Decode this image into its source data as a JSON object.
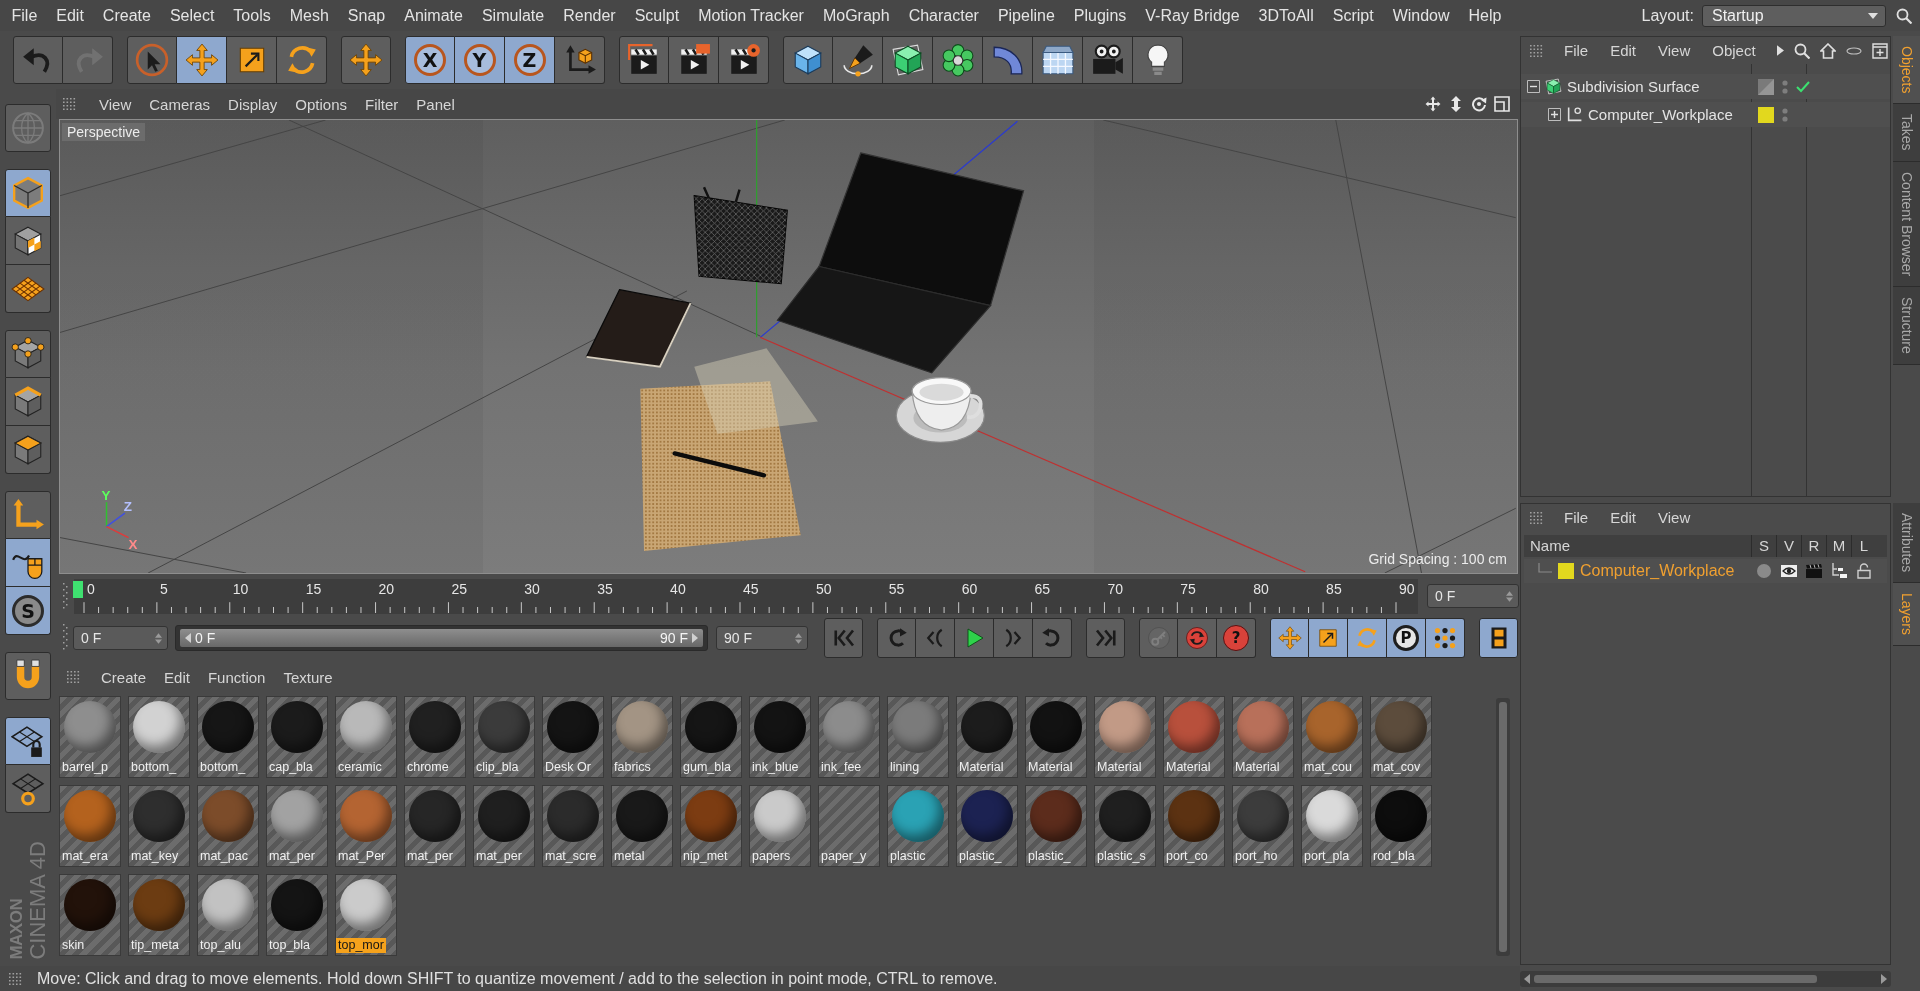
{
  "menu_bar": {
    "items": [
      "File",
      "Edit",
      "Create",
      "Select",
      "Tools",
      "Mesh",
      "Snap",
      "Animate",
      "Simulate",
      "Render",
      "Sculpt",
      "Motion Tracker",
      "MoGraph",
      "Character",
      "Pipeline",
      "Plugins",
      "V-Ray Bridge",
      "3DToAll",
      "Script",
      "Window",
      "Help"
    ],
    "layout_label": "Layout:",
    "layout_value": "Startup"
  },
  "toolbar": [
    [
      {
        "kind": "undo",
        "disabled": false
      },
      {
        "kind": "redo",
        "disabled": true
      }
    ],
    [
      {
        "kind": "live_select",
        "selected": false
      },
      {
        "kind": "move",
        "selected": true
      },
      {
        "kind": "scale",
        "selected": false
      },
      {
        "kind": "rotate",
        "selected": false
      }
    ],
    [
      {
        "kind": "recent_tool",
        "selected": false
      }
    ],
    [
      {
        "kind": "axis_lock",
        "label": "X",
        "selected": true
      },
      {
        "kind": "axis_lock",
        "label": "Y",
        "selected": true
      },
      {
        "kind": "axis_lock",
        "label": "Z",
        "selected": true
      },
      {
        "kind": "coordinate_system",
        "selected": false
      }
    ],
    [
      {
        "kind": "render_view"
      },
      {
        "kind": "render_picture"
      },
      {
        "kind": "render_settings"
      }
    ],
    [
      {
        "kind": "cube"
      },
      {
        "kind": "pen"
      },
      {
        "kind": "subdivision"
      },
      {
        "kind": "cloner"
      },
      {
        "kind": "bend"
      },
      {
        "kind": "floor"
      },
      {
        "kind": "camera"
      },
      {
        "kind": "light"
      }
    ]
  ],
  "left_toolbar": [
    [
      {
        "kind": "make_editable",
        "disabled": true
      }
    ],
    [
      {
        "kind": "model",
        "selected": true
      },
      {
        "kind": "texture",
        "selected": false
      },
      {
        "kind": "workplane",
        "selected": false
      }
    ],
    [
      {
        "kind": "points",
        "selected": false
      },
      {
        "kind": "edges",
        "selected": false
      },
      {
        "kind": "polygons",
        "selected": false
      }
    ],
    [
      {
        "kind": "axis",
        "selected": false
      },
      {
        "kind": "tweak",
        "selected": true
      },
      {
        "kind": "solo",
        "label": "S",
        "selected": true
      }
    ],
    [
      {
        "kind": "magnet",
        "selected": false
      }
    ],
    [
      {
        "kind": "lock_workplane",
        "selected": true
      },
      {
        "kind": "planar_workplane",
        "selected": false
      }
    ]
  ],
  "logo": {
    "brand": "MAXON",
    "product": "CINEMA 4D"
  },
  "viewport": {
    "menu": [
      "View",
      "Cameras",
      "Display",
      "Options",
      "Filter",
      "Panel"
    ],
    "camera": "Perspective",
    "grid_spacing": "Grid Spacing : 100 cm",
    "axis_labels": [
      "Y",
      "Z",
      "X"
    ]
  },
  "timeline": {
    "labels": [
      "0",
      "5",
      "10",
      "15",
      "20",
      "25",
      "30",
      "35",
      "40",
      "45",
      "50",
      "55",
      "60",
      "65",
      "70",
      "75",
      "80",
      "85",
      "90"
    ],
    "level": 0,
    "current_frame": "0 F"
  },
  "transport": {
    "start_frame": "0 F",
    "range": {
      "start": "0 F",
      "end": "90 F",
      "level": 1
    },
    "end_frame": "90 F",
    "buttons": [
      [
        {
          "kind": "goto_start"
        }
      ],
      [
        {
          "kind": "prev_key"
        },
        {
          "kind": "prev_frame"
        },
        {
          "kind": "play"
        },
        {
          "kind": "next_frame"
        },
        {
          "kind": "next_key"
        }
      ],
      [
        {
          "kind": "goto_end"
        }
      ],
      [
        {
          "kind": "record",
          "disabled": true
        },
        {
          "kind": "autokey",
          "disabled": false
        },
        {
          "kind": "keyframe_selection",
          "label": "?",
          "disabled": false
        }
      ],
      [
        {
          "kind": "key_move",
          "selected": true
        },
        {
          "kind": "key_scale",
          "selected": true
        },
        {
          "kind": "key_rotate",
          "selected": true
        },
        {
          "kind": "key_param",
          "label": "P",
          "selected": true
        },
        {
          "kind": "key_points",
          "selected": true
        }
      ],
      [
        {
          "kind": "timeline",
          "selected": true
        }
      ]
    ]
  },
  "materials": {
    "menu": [
      "Create",
      "Edit",
      "Function",
      "Texture"
    ],
    "items": [
      {
        "name": "barrel_p",
        "color": "#8e8e8e",
        "selected": false
      },
      {
        "name": "bottom_",
        "color": "#d2d2d2",
        "selected": false
      },
      {
        "name": "bottom_",
        "color": "#161616",
        "selected": false
      },
      {
        "name": "cap_bla",
        "color": "#1b1b1b",
        "selected": false
      },
      {
        "name": "ceramic",
        "color": "#b9b9b9",
        "selected": false
      },
      {
        "name": "chrome",
        "color": "#202020",
        "selected": false
      },
      {
        "name": "clip_bla",
        "color": "#3b3b3b",
        "selected": false
      },
      {
        "name": "Desk Or",
        "color": "#141414",
        "selected": false
      },
      {
        "name": "fabrics",
        "color": "#a39484",
        "selected": false
      },
      {
        "name": "gum_bla",
        "color": "#151515",
        "selected": false
      },
      {
        "name": "ink_blue",
        "color": "#131313",
        "selected": false
      },
      {
        "name": "ink_fee",
        "color": "#8c8c8c",
        "selected": false
      },
      {
        "name": "lining",
        "color": "#7b7b7b",
        "selected": false
      },
      {
        "name": "Material",
        "color": "#1c1c1c",
        "selected": false
      },
      {
        "name": "Material",
        "color": "#121212",
        "selected": false
      },
      {
        "name": "Material",
        "color": "#c29a86",
        "selected": false
      },
      {
        "name": "Material",
        "color": "#b8503c",
        "selected": false
      },
      {
        "name": "Material",
        "color": "#b8705a",
        "selected": false
      },
      {
        "name": "mat_cou",
        "color": "#a8642c",
        "selected": false
      },
      {
        "name": "mat_cov",
        "color": "#5c4c3c",
        "selected": false
      },
      {
        "name": "mat_era",
        "color": "#b4621e",
        "selected": false
      },
      {
        "name": "mat_key",
        "color": "#2e2e2e",
        "selected": false
      },
      {
        "name": "mat_pac",
        "color": "#7c4c2a",
        "selected": false
      },
      {
        "name": "mat_per",
        "color": "#a2a2a2",
        "selected": false
      },
      {
        "name": "mat_Per",
        "color": "#b46432",
        "selected": false
      },
      {
        "name": "mat_per",
        "color": "#262626",
        "selected": false
      },
      {
        "name": "mat_per",
        "color": "#1f1f1f",
        "selected": false
      },
      {
        "name": "mat_scre",
        "color": "#2b2b2b",
        "selected": false
      },
      {
        "name": "metal",
        "color": "#191919",
        "selected": false
      },
      {
        "name": "nip_met",
        "color": "#7c3c12",
        "selected": false
      },
      {
        "name": "papers",
        "color": "#cacaca",
        "selected": false
      },
      {
        "name": "paper_y",
        "selected": false
      },
      {
        "name": "plastic",
        "color": "#2aa2b4",
        "selected": false
      },
      {
        "name": "plastic_",
        "color": "#1c2252",
        "selected": false
      },
      {
        "name": "plastic_",
        "color": "#5c2c1c",
        "selected": false
      },
      {
        "name": "plastic_s",
        "color": "#1f1f1f",
        "selected": false
      },
      {
        "name": "port_co",
        "color": "#5c3212",
        "selected": false
      },
      {
        "name": "port_ho",
        "color": "#3c3c3c",
        "selected": false
      },
      {
        "name": "port_pla",
        "color": "#dadada",
        "selected": false
      },
      {
        "name": "rod_bla",
        "color": "#0d0d0d",
        "selected": false
      },
      {
        "name": "skin",
        "color": "#22120a",
        "selected": false
      },
      {
        "name": "tip_meta",
        "color": "#6c3c12",
        "selected": false
      },
      {
        "name": "top_alu",
        "color": "#c2c2c2",
        "selected": false
      },
      {
        "name": "top_bla",
        "color": "#141414",
        "selected": false
      },
      {
        "name": "top_mor",
        "color": "#cbcbcb",
        "selected": true
      }
    ]
  },
  "status_bar": {
    "message": "Move: Click and drag to move elements. Hold down SHIFT to quantize movement / add to the selection in point mode, CTRL to remove."
  },
  "object_manager": {
    "menu": [
      "File",
      "Edit",
      "View",
      "Object"
    ],
    "objects": [
      {
        "name": "Subdivision Surface",
        "kind": "subdivision",
        "expanded": true,
        "selected": false,
        "enabled": true,
        "children": [
          {
            "name": "Computer_Workplace",
            "kind": "null",
            "expanded": false,
            "selected": false,
            "color": "#e2d81e"
          }
        ]
      }
    ]
  },
  "side_tabs": {
    "top": [
      {
        "label": "Objects",
        "selected": true
      },
      {
        "label": "Takes",
        "selected": false
      },
      {
        "label": "Content Browser",
        "selected": false
      },
      {
        "label": "Structure",
        "selected": false
      }
    ],
    "bottom": [
      {
        "label": "Attributes",
        "selected": false
      },
      {
        "label": "Layers",
        "selected": true
      }
    ]
  },
  "layer_manager": {
    "menu": [
      "File",
      "Edit",
      "View"
    ],
    "columns": [
      "Name",
      "S",
      "V",
      "R",
      "M",
      "L"
    ],
    "layers": [
      {
        "name": "Computer_Workplace",
        "color": "#e2d81e",
        "selected": true,
        "solo": false,
        "visible": true,
        "render": true,
        "manager": true,
        "locked": false
      }
    ]
  }
}
